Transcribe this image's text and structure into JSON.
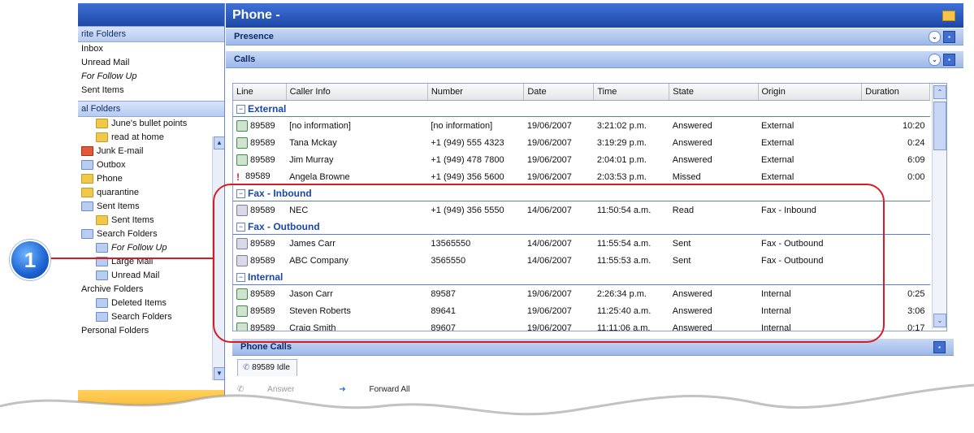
{
  "nav": {
    "favorites_header": "rite Folders",
    "favorites": [
      "Inbox",
      "Unread Mail",
      "For Follow Up",
      "Sent Items"
    ],
    "all_folders_header": "al Folders",
    "folders": [
      {
        "label": "June's bullet points",
        "indent": 1,
        "italic": false,
        "icon": "folder-icon"
      },
      {
        "label": "read at home",
        "indent": 1,
        "italic": false,
        "icon": "folder-icon"
      },
      {
        "label": "Junk E-mail",
        "indent": 0,
        "italic": false,
        "icon": "junk-folder-icon"
      },
      {
        "label": "Outbox",
        "indent": 0,
        "italic": false,
        "icon": "outbox-icon"
      },
      {
        "label": "Phone",
        "indent": 0,
        "italic": false,
        "icon": "folder-icon"
      },
      {
        "label": "quarantine",
        "indent": 0,
        "italic": false,
        "icon": "folder-icon"
      },
      {
        "label": "Sent Items",
        "indent": 0,
        "italic": false,
        "icon": "sent-folder-icon"
      },
      {
        "label": "Sent Items",
        "indent": 1,
        "italic": false,
        "icon": "folder-icon"
      },
      {
        "label": "Search Folders",
        "indent": 0,
        "italic": false,
        "icon": "search-folder-icon"
      },
      {
        "label": "For Follow Up",
        "indent": 1,
        "italic": true,
        "icon": "search-folder-icon"
      },
      {
        "label": "Large Mail",
        "indent": 1,
        "italic": false,
        "icon": "search-folder-icon"
      },
      {
        "label": "Unread Mail",
        "indent": 1,
        "italic": false,
        "icon": "search-folder-icon"
      },
      {
        "label": "Archive Folders",
        "indent": 0,
        "italic": false,
        "icon": "none"
      },
      {
        "label": "Deleted Items",
        "indent": 1,
        "italic": false,
        "icon": "deleted-items-icon"
      },
      {
        "label": "Search Folders",
        "indent": 1,
        "italic": false,
        "icon": "search-folder-icon"
      },
      {
        "label": "Personal Folders",
        "indent": 0,
        "italic": false,
        "icon": "none"
      }
    ]
  },
  "window": {
    "title": "Phone -"
  },
  "panels": {
    "presence": "Presence",
    "calls": "Calls",
    "phone_calls": "Phone Calls"
  },
  "table": {
    "columns": [
      "Line",
      "Caller Info",
      "Number",
      "Date",
      "Time",
      "State",
      "Origin",
      "Duration"
    ],
    "groups": [
      {
        "name": "External",
        "rows": [
          {
            "icon": "phone-icon",
            "line": "89589",
            "caller": "[no information]",
            "number": "[no information]",
            "date": "19/06/2007",
            "time": "3:21:02 p.m.",
            "state": "Answered",
            "origin": "External",
            "duration": "10:20"
          },
          {
            "icon": "phone-icon",
            "line": "89589",
            "caller": "Tana Mckay",
            "number": "+1 (949) 555 4323",
            "date": "19/06/2007",
            "time": "3:19:29 p.m.",
            "state": "Answered",
            "origin": "External",
            "duration": "0:24"
          },
          {
            "icon": "phone-icon",
            "line": "89589",
            "caller": "Jim Murray",
            "number": "+1 (949) 478 7800",
            "date": "19/06/2007",
            "time": "2:04:01 p.m.",
            "state": "Answered",
            "origin": "External",
            "duration": "6:09"
          },
          {
            "icon": "missed-icon",
            "line": "89589",
            "caller": "Angela Browne",
            "number": "+1 (949) 356 5600",
            "date": "19/06/2007",
            "time": "2:03:53 p.m.",
            "state": "Missed",
            "origin": "External",
            "duration": "0:00"
          }
        ]
      },
      {
        "name": "Fax - Inbound",
        "rows": [
          {
            "icon": "fax-icon",
            "line": "89589",
            "caller": "NEC",
            "number": "+1 (949) 356 5550",
            "date": "14/06/2007",
            "time": "11:50:54 a.m.",
            "state": "Read",
            "origin": "Fax - Inbound",
            "duration": ""
          }
        ]
      },
      {
        "name": "Fax - Outbound",
        "rows": [
          {
            "icon": "fax-icon",
            "line": "89589",
            "caller": "James Carr",
            "number": "13565550",
            "date": "14/06/2007",
            "time": "11:55:54 a.m.",
            "state": "Sent",
            "origin": "Fax - Outbound",
            "duration": ""
          },
          {
            "icon": "fax-icon",
            "line": "89589",
            "caller": "ABC Company",
            "number": "3565550",
            "date": "14/06/2007",
            "time": "11:55:53 a.m.",
            "state": "Sent",
            "origin": "Fax - Outbound",
            "duration": ""
          }
        ]
      },
      {
        "name": "Internal",
        "rows": [
          {
            "icon": "phone-icon",
            "line": "89589",
            "caller": "Jason Carr",
            "number": "89587",
            "date": "19/06/2007",
            "time": "2:26:34 p.m.",
            "state": "Answered",
            "origin": "Internal",
            "duration": "0:25"
          },
          {
            "icon": "phone-icon",
            "line": "89589",
            "caller": "Steven Roberts",
            "number": "89641",
            "date": "19/06/2007",
            "time": "11:25:40 a.m.",
            "state": "Answered",
            "origin": "Internal",
            "duration": "3:06"
          },
          {
            "icon": "phone-icon",
            "line": "89589",
            "caller": "Craig Smith",
            "number": "89607",
            "date": "19/06/2007",
            "time": "11:11:06 a.m.",
            "state": "Answered",
            "origin": "Internal",
            "duration": "0:17"
          }
        ]
      }
    ]
  },
  "phone_calls": {
    "tab_label": "89589 Idle",
    "action_answer": "Answer",
    "action_forward": "Forward All"
  },
  "callout": {
    "number": "1"
  },
  "colors": {
    "title_bar": "#1d47a6",
    "group_text": "#1a47a8",
    "callout_red": "#d71c24",
    "missed_red": "#d41e1e"
  }
}
